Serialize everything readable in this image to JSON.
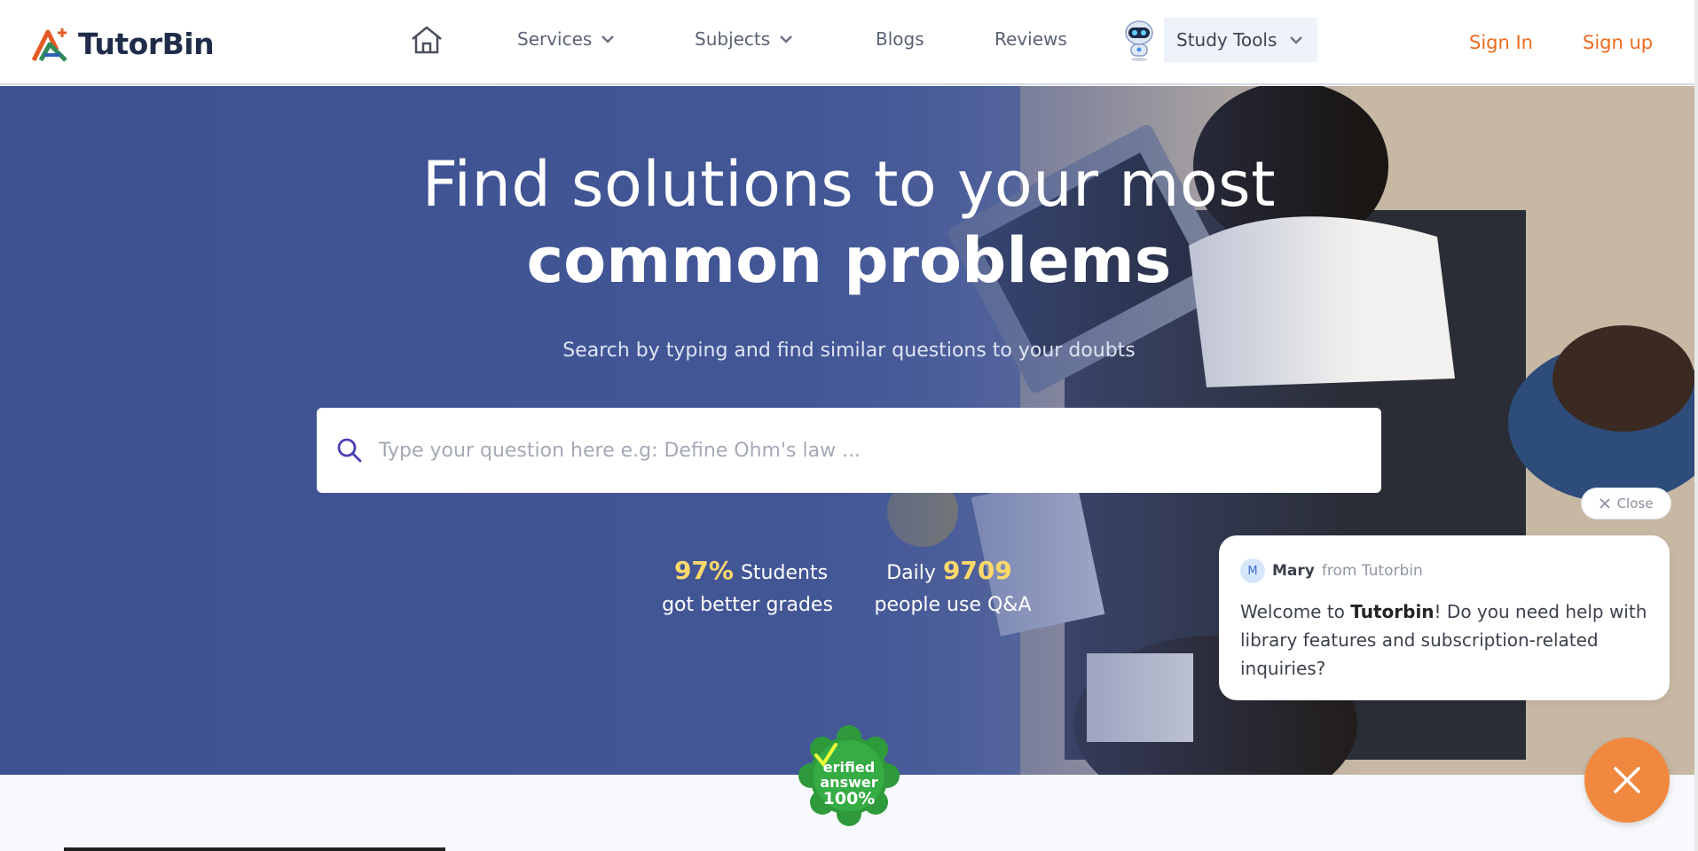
{
  "brand": {
    "name": "TutorBin"
  },
  "nav": {
    "items": [
      {
        "label": "Services"
      },
      {
        "label": "Subjects"
      },
      {
        "label": "Blogs"
      },
      {
        "label": "Reviews"
      }
    ],
    "study_tools": "Study Tools",
    "sign_in": "Sign In",
    "sign_up": "Sign up"
  },
  "hero": {
    "title_line1": "Find solutions to your most",
    "title_line2": "common problems",
    "subtitle": "Search by typing and find similar questions to your doubts",
    "search_placeholder": "Type your question here e.g: Define Ohm's law ...",
    "stats": [
      {
        "value": "97%",
        "label_inline": "Students",
        "label_line2": "got better grades"
      },
      {
        "prefix": "Daily",
        "value": "9709",
        "label_line2": "people use Q&A"
      }
    ]
  },
  "badge": {
    "line1": "erified",
    "line2": "answer",
    "line3": "100%"
  },
  "chat": {
    "close_label": "Close",
    "avatar_initial": "M",
    "agent_name": "Mary",
    "agent_from": "from Tutorbin",
    "msg_pre": "Welcome to ",
    "msg_brand": "Tutorbin",
    "msg_post": "! Do you need help with library features and subscription-related inquiries?"
  },
  "colors": {
    "accent": "#ee6a21",
    "stat_highlight": "#ffd86b",
    "hero_overlay": "#42569a",
    "fab": "#f0893f"
  },
  "icons": [
    "home-icon",
    "chevron-down-icon",
    "robot-icon",
    "search-icon",
    "close-icon",
    "check-icon"
  ]
}
